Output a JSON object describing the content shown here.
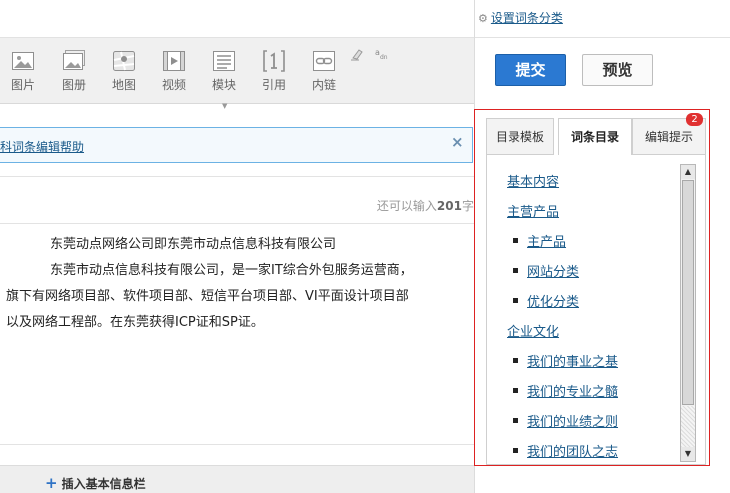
{
  "toolbar": {
    "tools": [
      {
        "label": "图片",
        "icon": "image-icon"
      },
      {
        "label": "图册",
        "icon": "album-icon"
      },
      {
        "label": "地图",
        "icon": "map-icon"
      },
      {
        "label": "视频",
        "icon": "video-icon"
      },
      {
        "label": "模块",
        "icon": "module-icon"
      },
      {
        "label": "引用",
        "icon": "reference-icon"
      },
      {
        "label": "内链",
        "icon": "internal-link-icon"
      }
    ]
  },
  "help": {
    "link_text": "百科词条编辑帮助",
    "close_glyph": "×"
  },
  "counter": {
    "prefix": "还可以输入",
    "value": "201",
    "suffix": "字"
  },
  "editor": {
    "lines": [
      "东莞动点网络公司即东莞市动点信息科技有限公司",
      "东莞市动点信息科技有限公司，是一家IT综合外包服务运营商，",
      "旗下有网络项目部、软件项目部、短信平台项目部、VI平面设计项目部",
      "以及网络工程部。在东莞获得ICP证和SP证。"
    ]
  },
  "bottom": {
    "insert_label": "插入基本信息栏",
    "plus": "+"
  },
  "sidebar": {
    "settings_link": "设置词条分类",
    "submit_label": "提交",
    "preview_label": "预览",
    "tabs": [
      {
        "label": "目录模板"
      },
      {
        "label": "词条目录"
      },
      {
        "label": "编辑提示"
      }
    ],
    "badge": "2",
    "toc": [
      {
        "label": "基本内容",
        "level": 1
      },
      {
        "label": "主营产品",
        "level": 1
      },
      {
        "label": "主产品",
        "level": 2
      },
      {
        "label": "网站分类",
        "level": 2
      },
      {
        "label": "优化分类",
        "level": 2
      },
      {
        "label": "企业文化",
        "level": 1
      },
      {
        "label": "我们的事业之基",
        "level": 2
      },
      {
        "label": "我们的专业之髓",
        "level": 2
      },
      {
        "label": "我们的业绩之则",
        "level": 2
      },
      {
        "label": "我们的团队之志",
        "level": 2
      }
    ]
  },
  "colors": {
    "accent": "#2b79d2",
    "link": "#1a5a8a",
    "panel_outline": "#dd2222",
    "badge": "#e03030"
  }
}
